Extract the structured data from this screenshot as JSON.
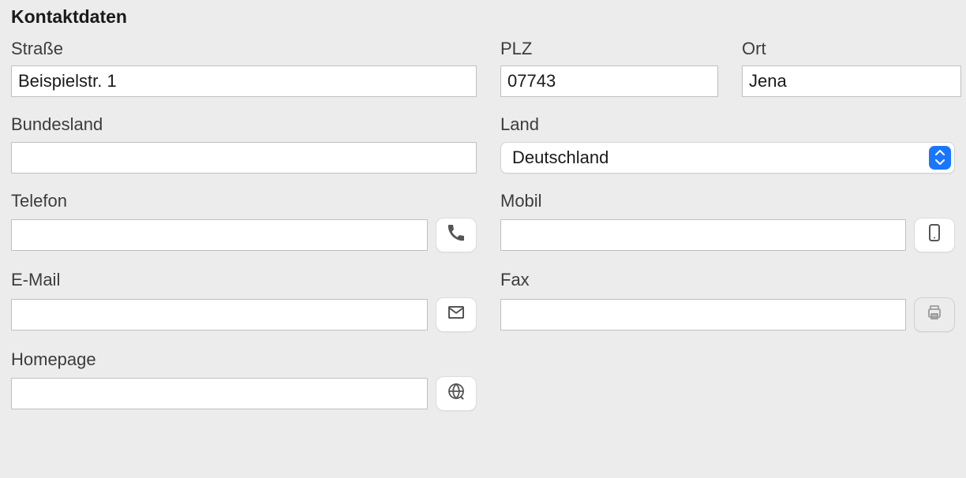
{
  "section_title": "Kontaktdaten",
  "labels": {
    "street": "Straße",
    "plz": "PLZ",
    "ort": "Ort",
    "bundesland": "Bundesland",
    "land": "Land",
    "telefon": "Telefon",
    "mobil": "Mobil",
    "email": "E-Mail",
    "fax": "Fax",
    "homepage": "Homepage"
  },
  "values": {
    "street": "Beispielstr. 1",
    "plz": "07743",
    "ort": "Jena",
    "bundesland": "",
    "land": "Deutschland",
    "telefon": "",
    "mobil": "",
    "email": "",
    "fax": "",
    "homepage": ""
  }
}
